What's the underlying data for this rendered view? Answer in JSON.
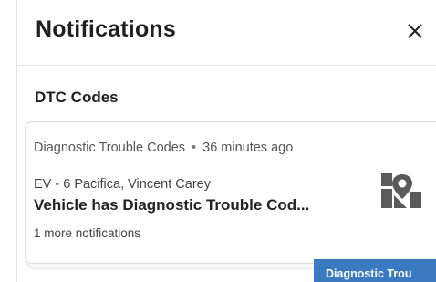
{
  "header": {
    "title": "Notifications",
    "close_label": "×"
  },
  "section": {
    "title": "DTC Codes"
  },
  "notification": {
    "category": "Diagnostic Trouble Codes",
    "separator": "•",
    "time": "36 minutes ago",
    "vehicle": "EV - 6 Pacifica, Vincent Carey",
    "message": "Vehicle has Diagnostic Trouble Cod...",
    "more": "1 more notifications",
    "icon": "map-location-icon"
  },
  "tooltip": {
    "text": "Diagnostic Trou"
  },
  "colors": {
    "tooltip_bg": "#3b79c0",
    "icon": "#5a5a5a",
    "border": "#dcdcdc"
  }
}
